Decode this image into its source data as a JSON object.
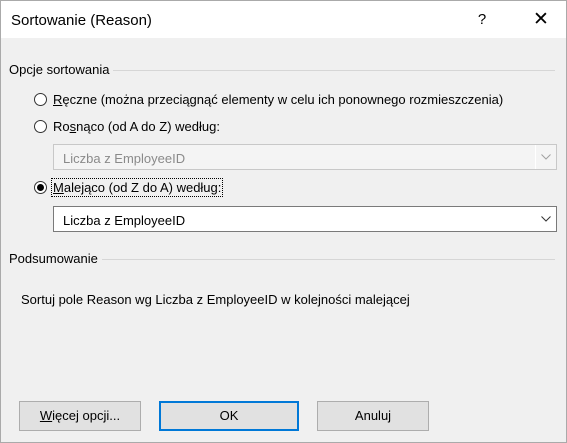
{
  "window": {
    "title": "Sortowanie (Reason)",
    "help_glyph": "?",
    "close_glyph": "✕"
  },
  "options": {
    "group_label": "Opcje sortowania",
    "manual": {
      "accel": "R",
      "rest": "ęczne (można przeciągnąć elementy w celu ich ponownego rozmieszczenia)",
      "checked": false
    },
    "ascending": {
      "pre": "Ro",
      "accel": "s",
      "rest": "nąco (od A do Z) według:",
      "checked": false
    },
    "ascending_select": {
      "value": "Liczba z EmployeeID",
      "enabled": false
    },
    "descending": {
      "accel": "M",
      "rest": "alejąco (od Z do A) według:",
      "checked": true
    },
    "descending_select": {
      "value": "Liczba z EmployeeID",
      "enabled": true
    }
  },
  "summary": {
    "group_label": "Podsumowanie",
    "text": "Sortuj pole Reason wg Liczba z EmployeeID w kolejności malejącej"
  },
  "buttons": {
    "more_accel": "W",
    "more_rest": "ięcej opcji...",
    "ok": "OK",
    "cancel": "Anuluj"
  }
}
